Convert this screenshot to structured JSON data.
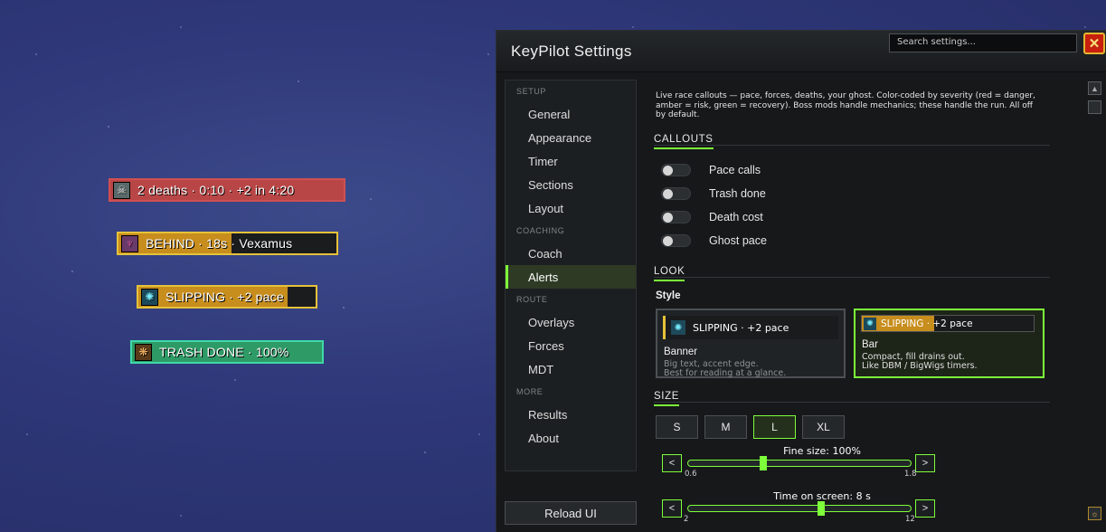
{
  "preview_alerts": [
    {
      "text": "2 deaths · 0:10 · +2 in 4:20",
      "icon": "skull-icon",
      "border": "#d05050",
      "fill": "#b94646",
      "fill_pct": 100
    },
    {
      "text": "BEHIND · 18s · Vexamus",
      "icon": "boss-portrait-icon",
      "border": "#e5c23a",
      "fill": "#c78d1d",
      "fill_pct": 52
    },
    {
      "text": "SLIPPING · +2 pace",
      "icon": "rune-icon",
      "border": "#e5c23a",
      "fill": "#c78d1d",
      "fill_pct": 84
    },
    {
      "text": "TRASH DONE · 100%",
      "icon": "paw-icon",
      "border": "#3fd9a8",
      "fill": "#2e9a66",
      "fill_pct": 100
    }
  ],
  "window": {
    "title": "KeyPilot Settings",
    "search_placeholder": "Search settings...",
    "close_label": "✕"
  },
  "nav": {
    "sections": [
      {
        "label": "SETUP",
        "items": [
          "General",
          "Appearance",
          "Timer",
          "Sections",
          "Layout"
        ]
      },
      {
        "label": "COACHING",
        "items": [
          "Coach",
          "Alerts"
        ]
      },
      {
        "label": "ROUTE",
        "items": [
          "Overlays",
          "Forces",
          "MDT"
        ]
      },
      {
        "label": "MORE",
        "items": [
          "Results",
          "About"
        ]
      }
    ],
    "active": "Alerts",
    "reload_label": "Reload UI"
  },
  "content": {
    "intro": "Live race callouts — pace, forces, deaths, your ghost. Color-coded by severity (red = danger, amber = risk, green = recovery). Boss mods handle mechanics; these handle the run. All off by default.",
    "callouts_header": "CALLOUTS",
    "toggles": [
      {
        "label": "Pace calls",
        "on": false
      },
      {
        "label": "Trash done",
        "on": false
      },
      {
        "label": "Death cost",
        "on": false
      },
      {
        "label": "Ghost pace",
        "on": false
      }
    ],
    "look_header": "LOOK",
    "style_label": "Style",
    "styles": [
      {
        "name": "Banner",
        "desc1": "Big text, accent edge.",
        "desc2": "Best for reading at a glance.",
        "preview_text": "SLIPPING · +2 pace",
        "selected": false
      },
      {
        "name": "Bar",
        "desc1": "Compact, fill drains out.",
        "desc2": "Like DBM / BigWigs timers.",
        "preview_text": "SLIPPING · +2 pace",
        "selected": true
      }
    ],
    "size_header": "SIZE",
    "sizes": [
      "S",
      "M",
      "L",
      "XL"
    ],
    "size_selected": "L",
    "fine_size": {
      "label": "Fine size:  100%",
      "min": "0.6",
      "max": "1.8",
      "value": 1.0,
      "range": [
        0.6,
        1.8
      ]
    },
    "time_on_screen": {
      "label": "Time on screen:  8 s",
      "min": "2",
      "max": "12",
      "value": 8,
      "range": [
        2,
        12
      ]
    },
    "arrow_left": "<",
    "arrow_right": ">"
  },
  "colors": {
    "accent": "#7dff3a",
    "close_red": "#c81f0e"
  }
}
